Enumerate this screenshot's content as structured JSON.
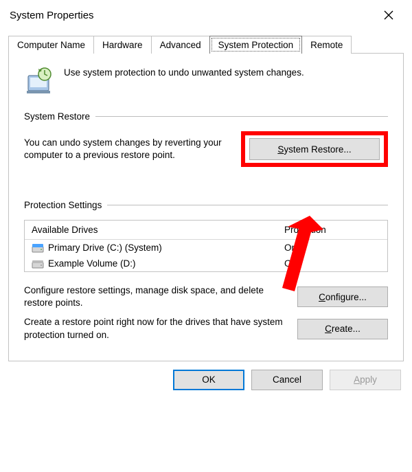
{
  "window": {
    "title": "System Properties"
  },
  "tabs": {
    "computer_name": "Computer Name",
    "hardware": "Hardware",
    "advanced": "Advanced",
    "system_protection": "System Protection",
    "remote": "Remote"
  },
  "intro": {
    "text": "Use system protection to undo unwanted system changes."
  },
  "restore_section": {
    "title": "System Restore",
    "desc": "You can undo system changes by reverting your computer to a previous restore point.",
    "button_prefix": "S",
    "button_rest": "ystem Restore..."
  },
  "protection_section": {
    "title": "Protection Settings",
    "headers": {
      "drives": "Available Drives",
      "protection": "Protection"
    },
    "rows": [
      {
        "drive": "Primary Drive (C:) (System)",
        "protection": "On",
        "icon": "primary"
      },
      {
        "drive": "Example Volume (D:)",
        "protection": "Off",
        "icon": "secondary"
      }
    ],
    "configure_desc": "Configure restore settings, manage disk space, and delete restore points.",
    "configure_prefix": "C",
    "configure_rest": "onfigure...",
    "create_desc": "Create a restore point right now for the drives that have system protection turned on.",
    "create_prefix": "C",
    "create_rest": "reate..."
  },
  "footer": {
    "ok": "OK",
    "cancel": "Cancel",
    "apply_prefix": "A",
    "apply_rest": "pply"
  }
}
